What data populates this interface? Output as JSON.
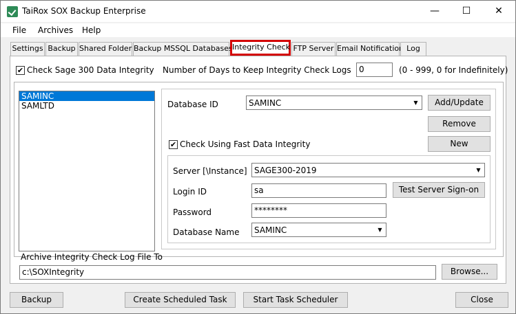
{
  "window": {
    "title": "TaiRox SOX Backup Enterprise"
  },
  "controls": {
    "minimize": "—",
    "maximize": "☐",
    "close": "✕"
  },
  "menu": [
    "File",
    "Archives",
    "Help"
  ],
  "tabs": [
    "Settings",
    "Backup",
    "Shared Folder",
    "Backup MSSQL Databases",
    "Integrity Check",
    "FTP Server",
    "Email Notification",
    "Log"
  ],
  "integrity": {
    "check_label": "Check Sage 300 Data Integrity",
    "check_mark": "✔",
    "days_label": "Number of Days to Keep Integrity Check Logs",
    "days_value": "0",
    "days_hint": "(0 - 999, 0 for Indefinitely)",
    "companies": [
      "SAMINC",
      "SAMLTD"
    ],
    "db_id_label": "Database ID",
    "db_id_value": "SAMINC",
    "add_update": "Add/Update",
    "remove": "Remove",
    "new": "New",
    "fast_label": "Check Using Fast Data Integrity",
    "server_label": "Server [\\Instance]",
    "server_value": "SAGE300-2019",
    "login_label": "Login ID",
    "login_value": "sa",
    "test_button": "Test Server Sign-on",
    "password_label": "Password",
    "password_value": "********",
    "dbname_label": "Database Name",
    "dbname_value": "SAMINC",
    "archive_label": "Archive Integrity Check Log File To",
    "archive_value": "c:\\SOXIntegrity",
    "browse": "Browse..."
  },
  "footer": {
    "backup": "Backup",
    "create_task": "Create Scheduled Task",
    "start_scheduler": "Start Task Scheduler",
    "close": "Close"
  }
}
